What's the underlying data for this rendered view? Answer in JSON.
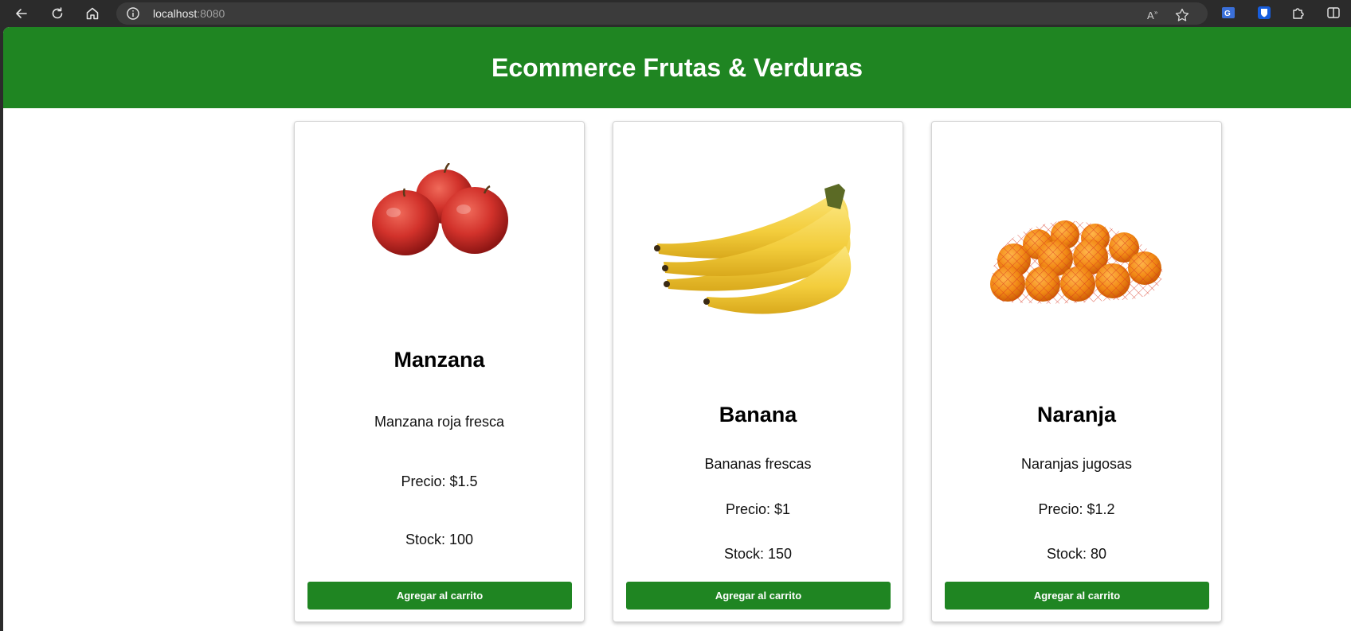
{
  "browser": {
    "url_host": "localhost",
    "url_port": ":8080"
  },
  "page": {
    "title": "Ecommerce Frutas & Verduras"
  },
  "products": [
    {
      "name": "Manzana",
      "description": "Manzana roja fresca",
      "price": "Precio: $1.5",
      "stock": "Stock: 100",
      "button_label": "Agregar al carrito",
      "image_icon": "apple-image"
    },
    {
      "name": "Banana",
      "description": "Bananas frescas",
      "price": "Precio: $1",
      "stock": "Stock: 150",
      "button_label": "Agregar al carrito",
      "image_icon": "banana-image"
    },
    {
      "name": "Naranja",
      "description": "Naranjas jugosas",
      "price": "Precio: $1.2",
      "stock": "Stock: 80",
      "button_label": "Agregar al carrito",
      "image_icon": "orange-image"
    }
  ],
  "colors": {
    "header_green": "#1f8522",
    "button_green": "#1f8522"
  }
}
